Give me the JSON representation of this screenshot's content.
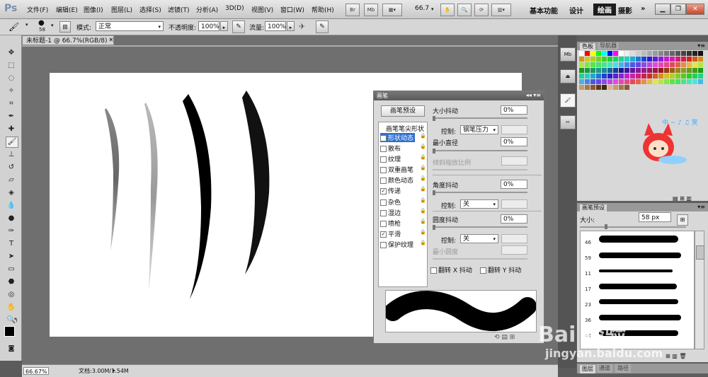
{
  "app": {
    "logo": "Ps",
    "menus": [
      "文件(F)",
      "编辑(E)",
      "图像(I)",
      "图层(L)",
      "选择(S)",
      "滤镜(T)",
      "分析(A)",
      "3D(D)",
      "视图(V)",
      "窗口(W)",
      "帮助(H)"
    ],
    "menubar_buttons": [
      "Br",
      "Mb"
    ],
    "zoom_value": "66.7",
    "workspaces": [
      "基本功能",
      "设计",
      "绘画",
      "摄影"
    ],
    "workspace_active": "绘画",
    "more": "»"
  },
  "options_bar": {
    "brush_size": "58",
    "mode_label": "模式:",
    "mode_value": "正常",
    "opacity_label": "不透明度:",
    "opacity_value": "100%",
    "flow_label": "流量:",
    "flow_value": "100%"
  },
  "document": {
    "tab_title": "未标题-1 @ 66.7%(RGB/8) *",
    "close_glyph": "×",
    "zoom_status": "66.67%",
    "doc_status": "文档:3.00M/1.54M"
  },
  "brush_panel": {
    "title": "画笔",
    "title_controls": "◂◂ ▾≡",
    "preset_button": "画笔预设",
    "tip_shape": "画笔笔尖形状",
    "items": [
      {
        "label": "形状动态",
        "checked": true,
        "selected": true
      },
      {
        "label": "散布",
        "checked": false
      },
      {
        "label": "纹理",
        "checked": false
      },
      {
        "label": "双重画笔",
        "checked": false
      },
      {
        "label": "颜色动态",
        "checked": false
      },
      {
        "label": "传递",
        "checked": true
      },
      {
        "label": "杂色",
        "checked": false
      },
      {
        "label": "湿边",
        "checked": false
      },
      {
        "label": "喷枪",
        "checked": false
      },
      {
        "label": "平滑",
        "checked": true
      },
      {
        "label": "保护纹理",
        "checked": false
      }
    ],
    "size_jitter_label": "大小抖动",
    "size_jitter_value": "0%",
    "control_label": "控制:",
    "control_pen_pressure": "钢笔压力",
    "min_diameter_label": "最小直径",
    "min_diameter_value": "0%",
    "tilt_scale_label": "倾斜缩放比例",
    "angle_jitter_label": "角度抖动",
    "angle_jitter_value": "0%",
    "control_off": "关",
    "roundness_jitter_label": "圆度抖动",
    "roundness_jitter_value": "0%",
    "min_roundness_label": "最小圆度",
    "flip_x_label": "翻转 X 抖动",
    "flip_y_label": "翻转 Y 抖动",
    "bottom_icons": "⟲ ▤ ⊞"
  },
  "swatches_panel": {
    "tabs": [
      "色板",
      "导航器"
    ],
    "mascot_text": "中 ~ ♪ ♫ 笑"
  },
  "brush_presets_panel": {
    "tab": "画笔预设",
    "size_label": "大小:",
    "size_value": "58 px",
    "strokes": [
      {
        "num": "46"
      },
      {
        "num": "59"
      },
      {
        "num": "11"
      },
      {
        "num": "17"
      },
      {
        "num": "23"
      },
      {
        "num": "36"
      },
      {
        "num": "44"
      }
    ]
  },
  "layers_tabs": [
    "图层",
    "通道",
    "路径"
  ],
  "watermark": {
    "line1": "Bai 经验",
    "line2": "jingyan.baidu.com"
  },
  "colors": {
    "foreground": "#000000",
    "background": "#ffffff",
    "selection_blue": "#2f6fcf"
  }
}
